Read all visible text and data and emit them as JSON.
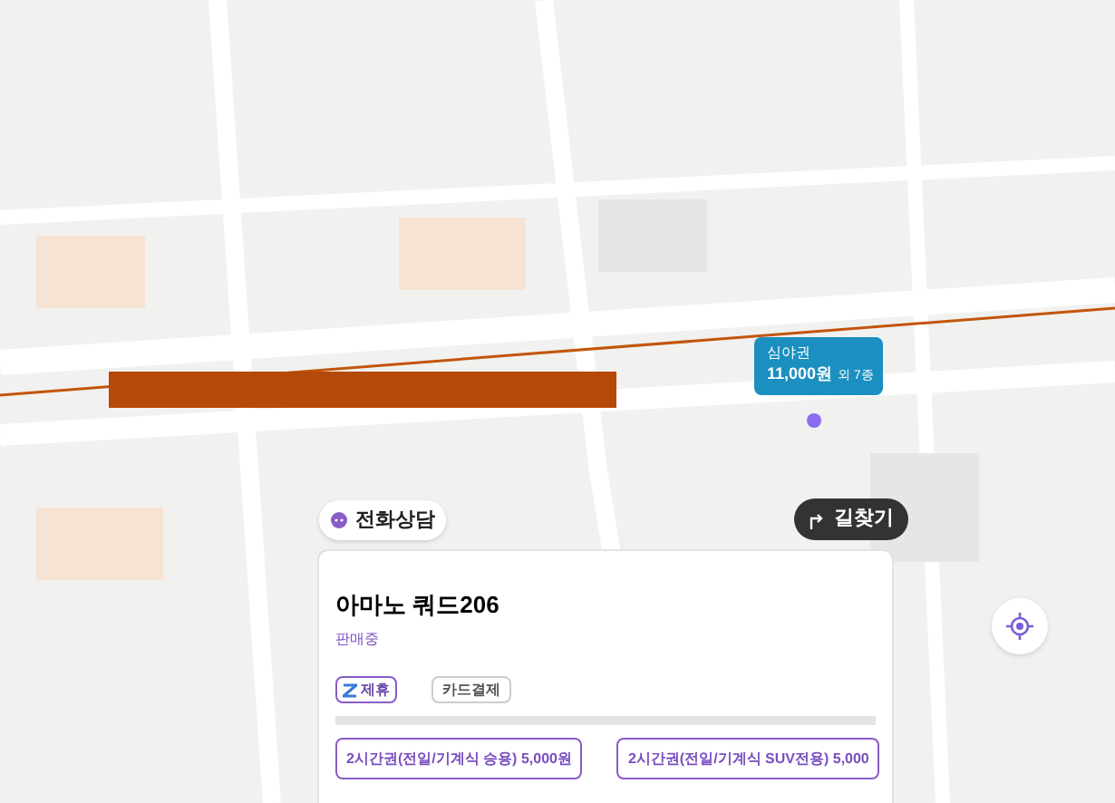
{
  "price_marker": {
    "label": "심야권",
    "price": "11,000원",
    "extra": "외 7종"
  },
  "phone_button": {
    "label": "전화상담"
  },
  "directions_button": {
    "label": "길찾기"
  },
  "card": {
    "title": "아마노 쿼드206",
    "status": "판매중",
    "tags": [
      {
        "label": "제휴",
        "kind": "partner"
      },
      {
        "label": "카드결제",
        "kind": "plain"
      }
    ],
    "tickets": [
      "2시간권(전일/기계식 승용) 5,000원",
      "2시간권(전일/기계식 SUV전용) 5,000"
    ]
  }
}
